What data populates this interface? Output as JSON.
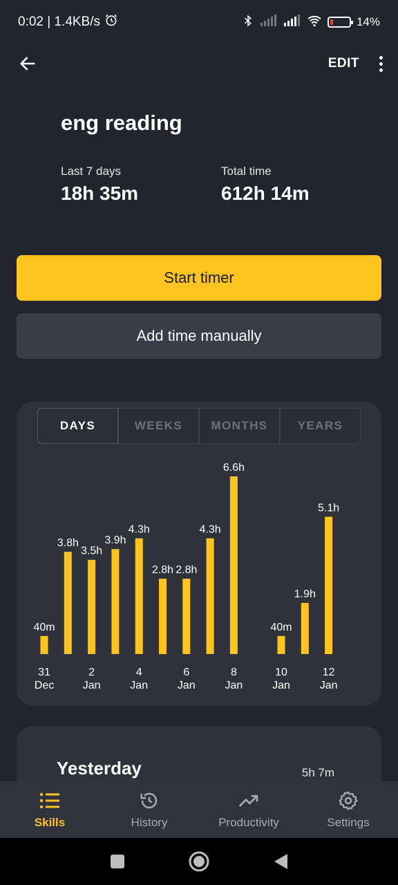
{
  "status_bar": {
    "time_speed": "0:02 | 1.4KB/s",
    "battery": "14%"
  },
  "app_bar": {
    "edit_label": "EDIT"
  },
  "skill": {
    "title": "eng reading",
    "last7_label": "Last 7 days",
    "last7_value": "18h 35m",
    "total_label": "Total time",
    "total_value": "612h 14m"
  },
  "buttons": {
    "start_timer": "Start timer",
    "add_time": "Add time manually"
  },
  "chart_tabs": [
    "DAYS",
    "WEEKS",
    "MONTHS",
    "YEARS"
  ],
  "chart_active_tab": "DAYS",
  "chart_data": {
    "type": "bar",
    "categories": [
      "31 Dec",
      "1 Jan",
      "2 Jan",
      "3 Jan",
      "4 Jan",
      "5 Jan",
      "6 Jan",
      "7 Jan",
      "8 Jan",
      "9 Jan",
      "10 Jan",
      "11 Jan",
      "12 Jan"
    ],
    "values": [
      0.67,
      3.8,
      3.5,
      3.9,
      4.3,
      2.8,
      2.8,
      4.3,
      6.6,
      0,
      0.67,
      1.9,
      5.1
    ],
    "value_labels": [
      "40m",
      "3.8h",
      "3.5h",
      "3.9h",
      "4.3h",
      "2.8h",
      "2.8h",
      "4.3h",
      "6.6h",
      "",
      "40m",
      "1.9h",
      "5.1h"
    ],
    "x_tick_labels": [
      {
        "day": "31",
        "month": "Dec"
      },
      {
        "day": "",
        "month": ""
      },
      {
        "day": "2",
        "month": "Jan"
      },
      {
        "day": "",
        "month": ""
      },
      {
        "day": "4",
        "month": "Jan"
      },
      {
        "day": "",
        "month": ""
      },
      {
        "day": "6",
        "month": "Jan"
      },
      {
        "day": "",
        "month": ""
      },
      {
        "day": "8",
        "month": "Jan"
      },
      {
        "day": "",
        "month": ""
      },
      {
        "day": "10",
        "month": "Jan"
      },
      {
        "day": "",
        "month": ""
      },
      {
        "day": "12",
        "month": "Jan"
      }
    ],
    "bar_color": "#fdc420",
    "ylim": [
      0,
      6.6
    ],
    "grid": false
  },
  "summary": {
    "title": "Yesterday",
    "value": "5h 7m"
  },
  "bottom_nav": [
    {
      "label": "Skills",
      "icon": "list-icon",
      "active": true
    },
    {
      "label": "History",
      "icon": "history-icon",
      "active": false
    },
    {
      "label": "Productivity",
      "icon": "trending-up-icon",
      "active": false
    },
    {
      "label": "Settings",
      "icon": "gear-icon",
      "active": false
    }
  ],
  "colors": {
    "background": "#22252d",
    "card": "#2f323b",
    "accent": "#fdc420",
    "secondary_button": "#383d47"
  }
}
